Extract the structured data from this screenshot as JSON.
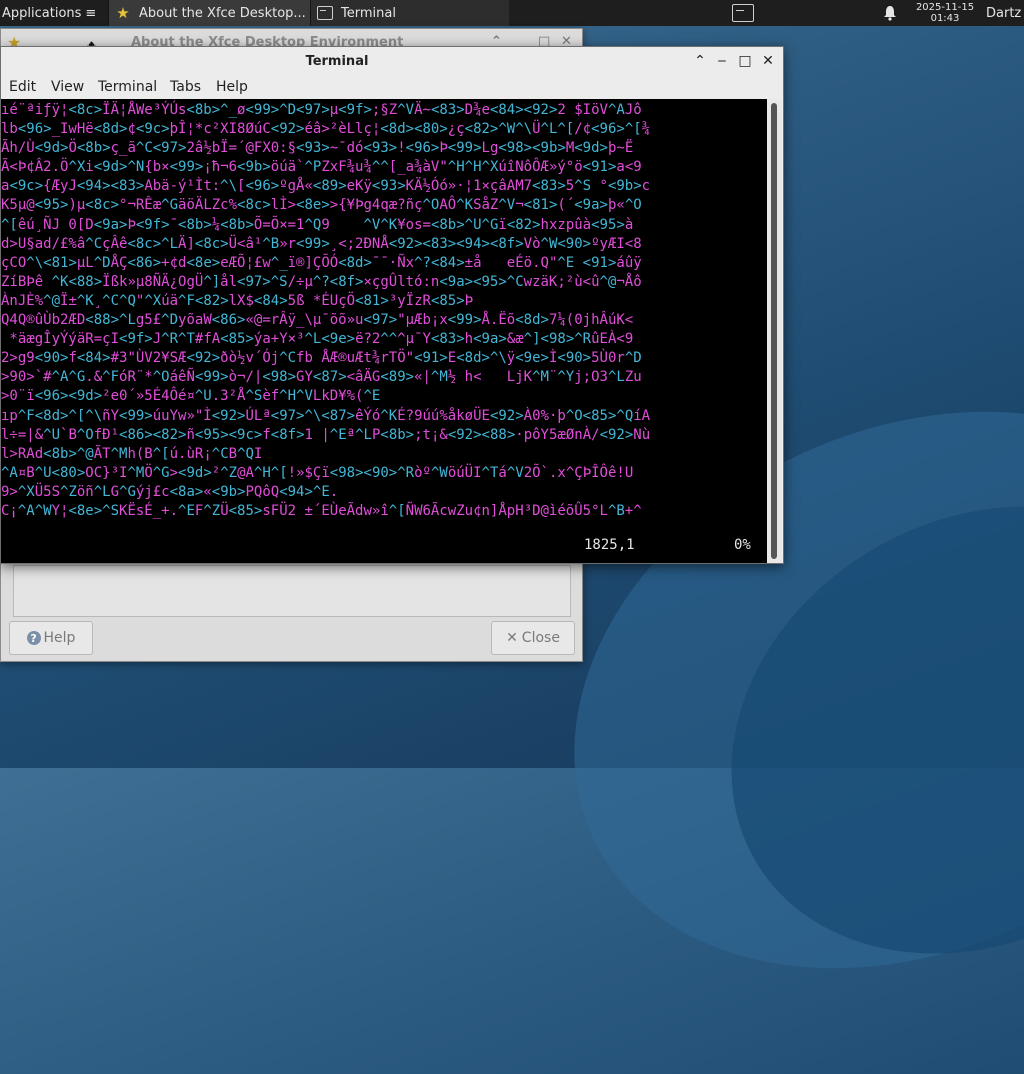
{
  "taskbar": {
    "applications_label": "Applications",
    "tasks": [
      {
        "label": "About the Xfce Desktop..."
      },
      {
        "label": "Terminal"
      }
    ],
    "clock_date": "2025-11-15",
    "clock_time": "01:43",
    "user": "Dartz"
  },
  "about_window": {
    "title": "About the Xfce Desktop Environment",
    "help_label": "Help",
    "close_label": "Close"
  },
  "terminal": {
    "title": "Terminal",
    "menu": [
      "Edit",
      "View",
      "Terminal",
      "Tabs",
      "Help"
    ],
    "status_position": "1825,1",
    "status_percent": "0%",
    "lines": [
      "ıé¨ªiƒÿ¦<8c>ÏÄ¦ÅWe³ÝÚs<8b>^_ø<99>^D<97>µ<9f>;§Z^VÄ~<83>D¾e<84><92>2 $IöV^AJô",
      "lb<96>_IwHë<8d>¢<9c>þÎ¦*c²XI8ØúC<92>éâ>²èLlç¦<8d><80>¿ç<82>^W^\\Ü^L^[/¢<96>^[¾",
      "Ãh/Ù<9d>Ö<8b>ç_ã^C<97>2â½bÏ=´@FX0:§<93>~¯dó<93>!<96>Þ<99>Lg<98><9b>M<9d>þ~Ë",
      "Ã<Þ¢Â2.Ö^Xi<9d>^N{b×<99>¡ħ¬6<9b>öúä`^PZxF¾u¾^^[_a¾àV\"^H^H^XúîNôÔÆ»ý°ö<91>a<9",
      "a<9c>{ÆyJ<94><83>Abä-ý¹Ìt:^\\[<96>ºgÅ«<89>eKÿ<93>KÄ½Óó»·¦1×çâAM7<83>5^S °<9b>c",
      "K5µ@<95>)µ<8c>°¬RÊæ^GäöÄLZc%<8c>lÌ><8e>>{¥Þg4qæ?ñç^OAÔ^KSåZ^V¬<81>(´<9a>þ«^O",
      "^[êú¸ÑJ 0[D<9a>Þ<9f>¯<8b>¼<8b>Õ=Õ×=1^Q9    ^V^K¥os=<8b>^U^Gï<82>hxzpûà<95>à",
      "d>U§ad/£%â^CçÂê<8c>^LÄ]<8c>Ü<â¹^B»r<99>¸<;2ÐNÅ<92><83><94><8f>Vò^W<90>ºyÆI<8",
      "çCO^\\<81>µL^DÅÇ<86>+¢d<8e>eÆÕ¦£w^_ï®]ÇÕÓ<8d>¯¯·Ñx^?<84>±å   eÉö.Q\"^E <91>áûÿ",
      "ZíBÞê ^K<88>Ïßk»µ8ÑÄ¿OgÜ^]ål<97>^S/÷µ^?<8f>×çgÛltó:n<9a><95>^CwzäK;²ù<û^@¬Åô",
      "ÀnJÈ%^@Ï±^K¸^C^Q\"^Xúä^F<82>lX$<84>5ß *ÉUçÖ<81>³yÏzR<85>Þ",
      "Q4Q®ûÙb2ÆD<88>^Lg5£^DyõaW<86>«@=rÂÿ_\\µ¯õõ»u<97>\"µÆb¡x<99>Å.Ëõ<8d>7¼(0jhÂúK<",
      " *äægÎyÝýäR=çI<9f>J^R^T#fA<85>ýa+Y×³^L<9e>ë?2^^^µ¯Y<83>h<9a>&æ^]<98>^RûEÀ<9",
      "2>g9<90>f<84>#3\"ÙV2¥SÆ<92>ðò½v´Ój^Cfb ÅÆ®uÆt¾rTÖ\"<91>E<8d>^\\ÿ<9e>Ì<90>5Ù0r^D",
      ">90>`#^A^G.&^FóR¨*^OáêÑ<99>ò¬/|<98>GY<87><âÄG<89>«|^M½ h<   LjK^M¨^Yj;O3^LZu",
      ">0¨ï<96><9d>²e0´»5É4Ôé¤^U.3²Å^Sèf^H^VLkD¥%(^E",
      "ıp^F<8d>^[^\\ñY<99>úuYw»\"Ì<92>ÚLª<97>^\\<87>êÝó^KÉ?9úú%åkøÜE<92>À0%·þ^O<85>^QíA",
      "l÷=|&^U`B^OfÐ¹<86><82>ñ<95><9c>f<8f>1 |^Eª^LP<8b>;t¡&<92><88>·pôY5æØnÀ/<92>Nù",
      "l>RAd<8b>^@ÃT^Mh(B^[ú.ùR¡^CB^QI",
      "^A¤B^U<80>OC}³I^MÖ^G><9d>²^Z@A^H^[!»$Çï<98><90>^Ròº^WöúÜI^Tá^V2Õ`.x^ÇÞÎÔê!U",
      "9>^XÜ5S^Zöñ^LG^Gýj£c<8a>«<9b>PQôQ<94>^E.",
      "C¡^A^WY¦<8e>^SKËsÉ_+.^EF^ZÜ<85>sFÜ2 ±´EÙeÃdw»î^[ÑW6ÃcwZu¢n]ÅpH³D@ìéõÛ5°L^B+^"
    ]
  }
}
